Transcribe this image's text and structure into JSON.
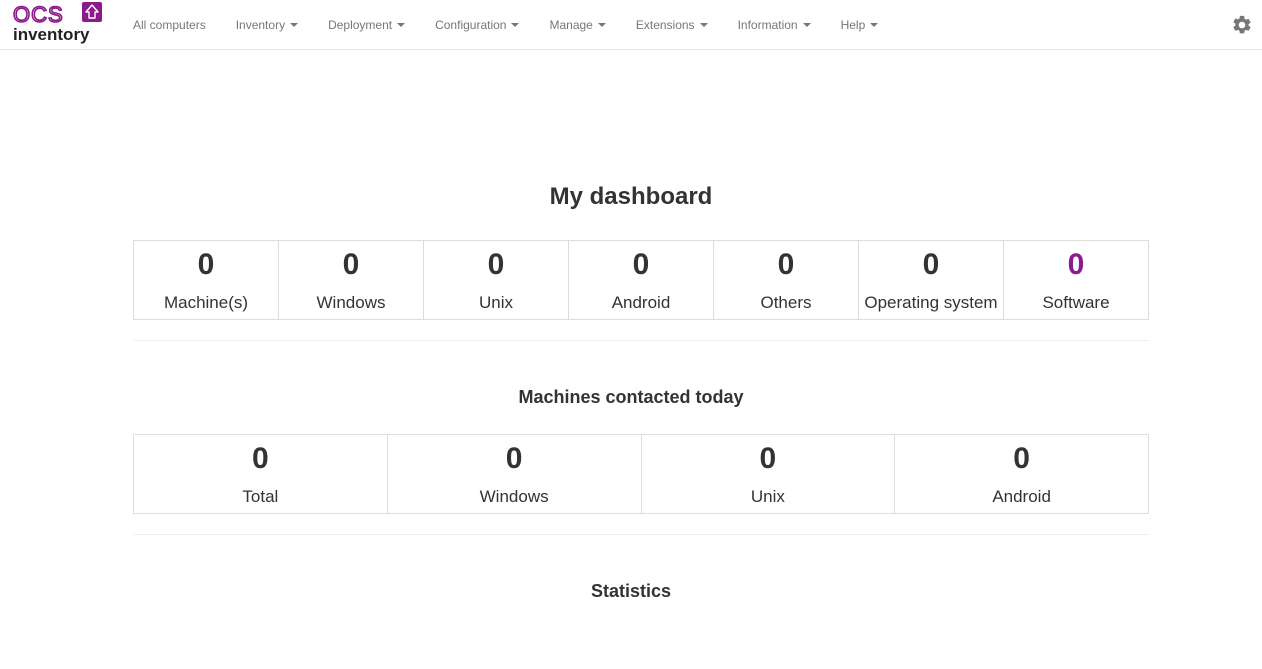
{
  "brand": {
    "logo_top": "OCS",
    "logo_bottom": "inventory",
    "accent_color": "#8b1a8b"
  },
  "nav": {
    "items": [
      {
        "label": "All computers",
        "dropdown": false
      },
      {
        "label": "Inventory",
        "dropdown": true
      },
      {
        "label": "Deployment",
        "dropdown": true
      },
      {
        "label": "Configuration",
        "dropdown": true
      },
      {
        "label": "Manage",
        "dropdown": true
      },
      {
        "label": "Extensions",
        "dropdown": true
      },
      {
        "label": "Information",
        "dropdown": true
      },
      {
        "label": "Help",
        "dropdown": true
      }
    ],
    "settings_icon": "gear-icon"
  },
  "dashboard": {
    "title": "My dashboard",
    "summary": [
      {
        "value": "0",
        "label": "Machine(s)"
      },
      {
        "value": "0",
        "label": "Windows"
      },
      {
        "value": "0",
        "label": "Unix"
      },
      {
        "value": "0",
        "label": "Android"
      },
      {
        "value": "0",
        "label": "Others"
      },
      {
        "value": "0",
        "label": "Operating system"
      },
      {
        "value": "0",
        "label": "Software"
      }
    ],
    "contacted_title": "Machines contacted today",
    "contacted": [
      {
        "value": "0",
        "label": "Total"
      },
      {
        "value": "0",
        "label": "Windows"
      },
      {
        "value": "0",
        "label": "Unix"
      },
      {
        "value": "0",
        "label": "Android"
      }
    ],
    "statistics_title": "Statistics"
  }
}
